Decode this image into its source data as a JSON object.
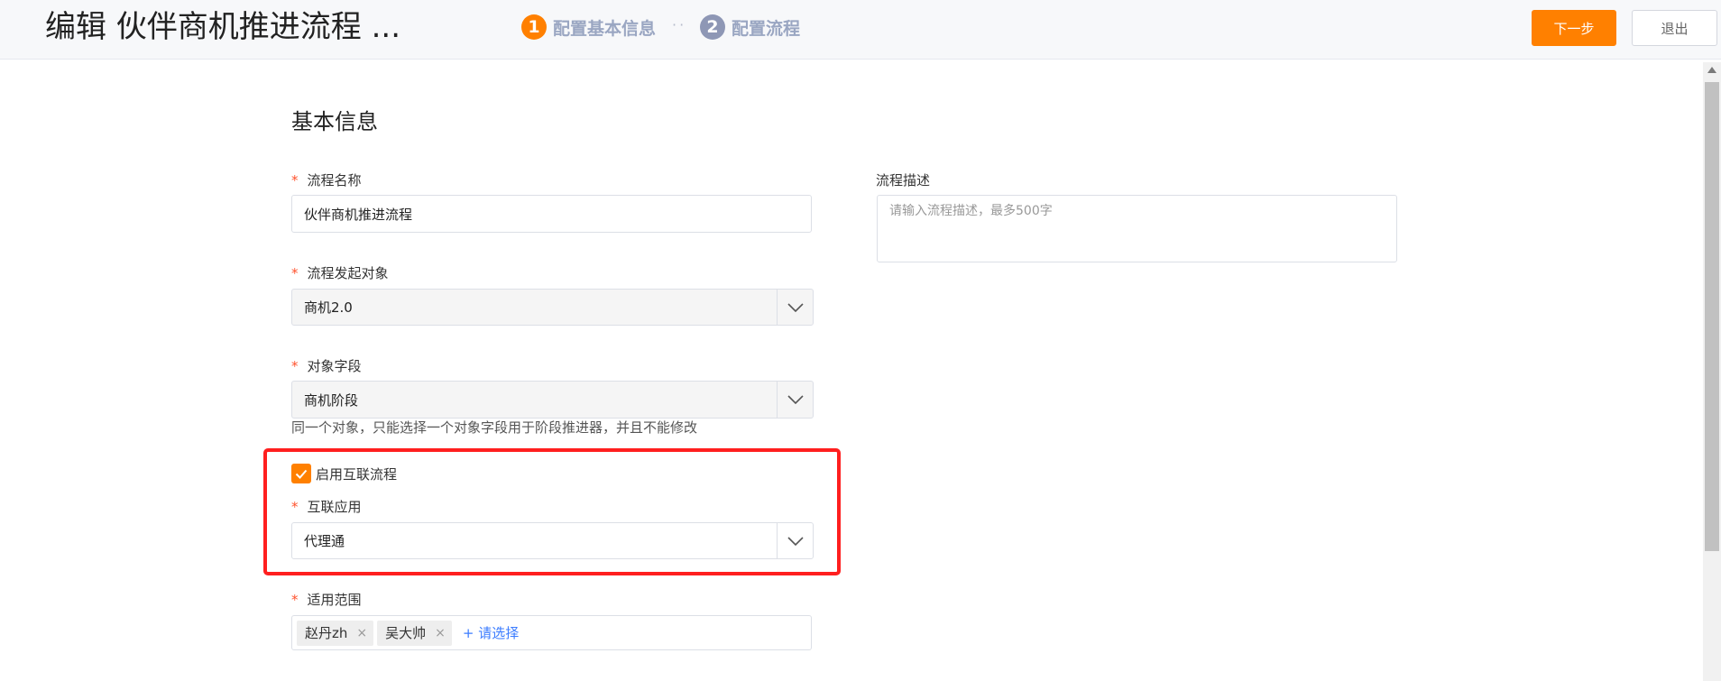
{
  "header": {
    "title": "编辑 伙伴商机推进流程 ...",
    "steps": [
      {
        "number": "1",
        "label": "配置基本信息",
        "color": "#ff8000"
      },
      {
        "number": "2",
        "label": "配置流程",
        "color": "#8e97b5"
      }
    ],
    "step_separator": "··",
    "next_label": "下一步",
    "exit_label": "退出"
  },
  "section": {
    "title": "基本信息"
  },
  "form": {
    "required_mark": "*",
    "flow_name": {
      "label": "流程名称",
      "value": "伙伴商机推进流程"
    },
    "flow_desc": {
      "label": "流程描述",
      "placeholder": "请输入流程描述，最多500字"
    },
    "trigger_object": {
      "label": "流程发起对象",
      "value": "商机2.0"
    },
    "object_field": {
      "label": "对象字段",
      "value": "商机阶段",
      "help": "同一个对象，只能选择一个对象字段用于阶段推进器，并且不能修改"
    },
    "enable_interconnect": {
      "label": "启用互联流程",
      "checked": true
    },
    "interconnect_app": {
      "label": "互联应用",
      "value": "代理通"
    },
    "scope": {
      "label": "适用范围",
      "tags": [
        "赵丹zh",
        "吴大帅"
      ],
      "tag_close": "×",
      "add_label": "+ 请选择"
    }
  },
  "colors": {
    "accent": "#ff8000",
    "highlight": "#ff1f1f",
    "link": "#3b7cff",
    "required": "#ff522d"
  }
}
